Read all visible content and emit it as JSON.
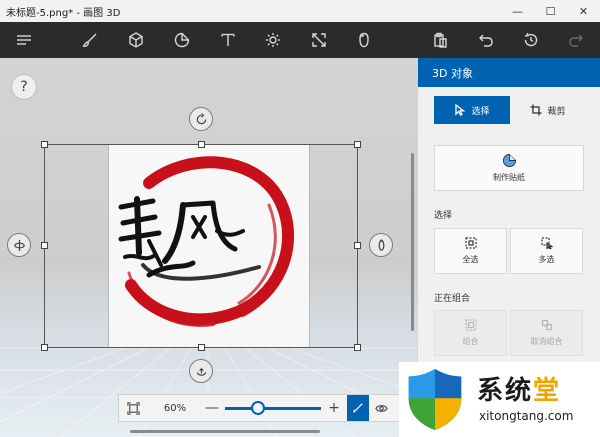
{
  "window": {
    "title": "未标题-5.png* - 画图 3D",
    "minimize": "—",
    "maximize": "☐",
    "close": "✕"
  },
  "toolbar": {
    "icons": [
      "menu-icon",
      "brush-icon",
      "3d-shapes-icon",
      "stickers-icon",
      "text-icon",
      "effects-icon",
      "canvas-icon",
      "3d-library-icon",
      "paste-icon",
      "undo-icon",
      "history-icon",
      "redo-icon"
    ]
  },
  "canvas": {
    "help_label": "?"
  },
  "zoom": {
    "percent_label": "60%",
    "minus": "—",
    "plus": "+",
    "level": 0.34
  },
  "panel": {
    "header": "3D 对象",
    "tabs": [
      {
        "label": "选择",
        "active": true
      },
      {
        "label": "裁剪",
        "active": false
      }
    ],
    "sticker_button": "制作贴纸",
    "select_section": "选择",
    "select_all": "全选",
    "multi_select": "多选",
    "group_section": "正在组合",
    "group": "组合",
    "ungroup": "取消组合"
  },
  "watermark": {
    "text_main": "系统",
    "text_accent": "堂",
    "url": "xitongtang.com"
  },
  "colors": {
    "accent": "#0063b1",
    "stamp_red": "#c8101b",
    "toolbar_bg": "#2b2b2b"
  }
}
